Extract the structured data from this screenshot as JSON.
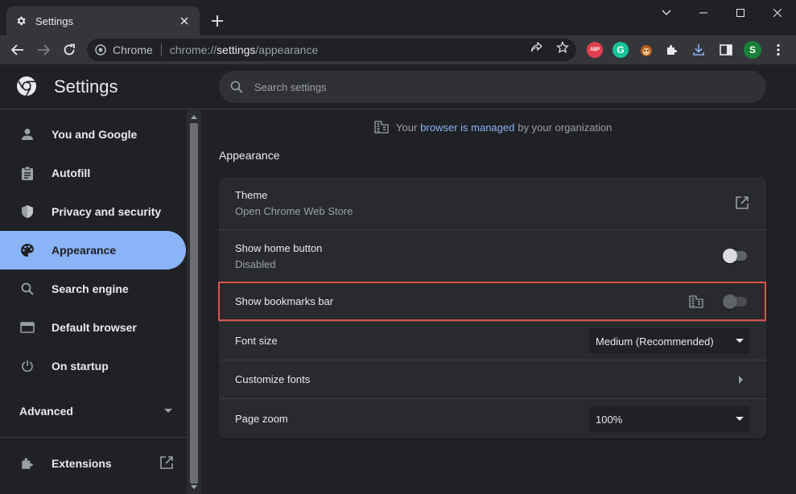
{
  "tab": {
    "title": "Settings"
  },
  "toolbar": {
    "site_label": "Chrome",
    "url_scheme": "chrome://",
    "url_host": "settings",
    "url_path": "/appearance",
    "ext_abp_label": "ABP",
    "ext_grammarly_label": "G",
    "profile_initial": "S"
  },
  "header": {
    "title": "Settings",
    "search_placeholder": "Search settings"
  },
  "sidebar": {
    "items": [
      {
        "label": "You and Google",
        "icon": "person-icon"
      },
      {
        "label": "Autofill",
        "icon": "clipboard-icon"
      },
      {
        "label": "Privacy and security",
        "icon": "shield-icon"
      },
      {
        "label": "Appearance",
        "icon": "palette-icon",
        "active": true
      },
      {
        "label": "Search engine",
        "icon": "search-icon"
      },
      {
        "label": "Default browser",
        "icon": "browser-icon"
      },
      {
        "label": "On startup",
        "icon": "power-icon"
      }
    ],
    "advanced_label": "Advanced",
    "extensions_label": "Extensions"
  },
  "main": {
    "managed_prefix": "Your",
    "managed_link": "browser is managed",
    "managed_suffix": "by your organization",
    "section_title": "Appearance",
    "theme": {
      "label": "Theme",
      "sub": "Open Chrome Web Store"
    },
    "home_button": {
      "label": "Show home button",
      "sub": "Disabled",
      "enabled": false
    },
    "bookmarks_bar": {
      "label": "Show bookmarks bar",
      "enabled": false,
      "policy_managed": true
    },
    "font_size": {
      "label": "Font size",
      "value": "Medium (Recommended)"
    },
    "customize_fonts": {
      "label": "Customize fonts"
    },
    "page_zoom": {
      "label": "Page zoom",
      "value": "100%"
    }
  },
  "colors": {
    "accent": "#8ab4f8",
    "highlight_border": "#e0534a",
    "background": "#202124",
    "card": "#292a2d"
  }
}
